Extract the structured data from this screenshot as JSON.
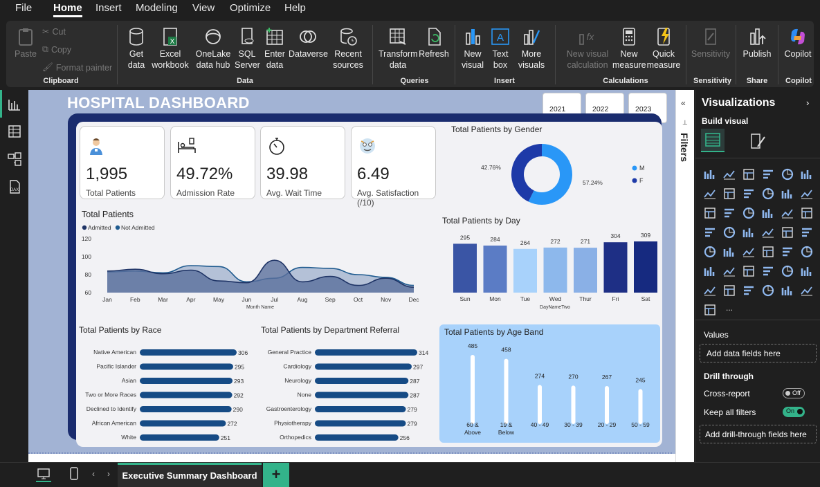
{
  "menu": [
    "File",
    "Home",
    "Insert",
    "Modeling",
    "View",
    "Optimize",
    "Help"
  ],
  "ribbon": {
    "clipboard": {
      "paste": "Paste",
      "cut": "Cut",
      "copy": "Copy",
      "format_painter": "Format painter",
      "group": "Clipboard"
    },
    "data": {
      "get_data": [
        "Get",
        "data"
      ],
      "excel": [
        "Excel",
        "workbook"
      ],
      "onelake": [
        "OneLake",
        "data hub"
      ],
      "sql": [
        "SQL",
        "Server"
      ],
      "enter": [
        "Enter",
        "data"
      ],
      "dataverse": "Dataverse",
      "recent": [
        "Recent",
        "sources"
      ],
      "group": "Data"
    },
    "queries": {
      "transform": [
        "Transform",
        "data"
      ],
      "refresh": "Refresh",
      "group": "Queries"
    },
    "insert": {
      "new_visual": [
        "New",
        "visual"
      ],
      "text_box": [
        "Text",
        "box"
      ],
      "more_visuals": [
        "More",
        "visuals"
      ],
      "group": "Insert"
    },
    "calculations": {
      "new_visual_calc": [
        "New visual",
        "calculation"
      ],
      "new_measure": [
        "New",
        "measure"
      ],
      "quick_measure": [
        "Quick",
        "measure"
      ],
      "group": "Calculations"
    },
    "sensitivity": {
      "label": "Sensitivity",
      "group": "Sensitivity"
    },
    "share": {
      "publish": "Publish",
      "group": "Share"
    },
    "copilot": {
      "label": "Copilot",
      "group": "Copilot"
    }
  },
  "dashboard": {
    "title": "HOSPITAL DASHBOARD",
    "years": [
      "2021",
      "2022",
      "2023"
    ],
    "kpis": [
      {
        "value": "1,995",
        "label": "Total Patients",
        "icon": "patient-icon"
      },
      {
        "value": "49.72%",
        "label": "Admission Rate",
        "icon": "hospital-bed-icon"
      },
      {
        "value": "39.98",
        "label": "Avg. Wait Time",
        "icon": "stopwatch-icon"
      },
      {
        "value": "6.49",
        "label": "Avg. Satisfaction (/10)",
        "icon": "satisfaction-face-icon"
      }
    ],
    "colors": {
      "navy": "#1a2c6e",
      "light_blue": "#a8d2fb",
      "bar_blue": "#164b85",
      "male": "#2997f7",
      "female": "#1e3aa8"
    }
  },
  "chart_data": [
    {
      "type": "pie",
      "title": "Total Patients by Gender",
      "labels": [
        "M",
        "F"
      ],
      "values": [
        57.24,
        42.76
      ],
      "value_labels": [
        "57.24%",
        "42.76%"
      ],
      "legend": "right",
      "colors": [
        "#2997f7",
        "#1e3aa8"
      ]
    },
    {
      "type": "area",
      "title": "Total Patients",
      "xlabel": "Month Name",
      "ylabel": "",
      "categories": [
        "Jan",
        "Feb",
        "Mar",
        "Apr",
        "May",
        "Jun",
        "Jul",
        "Aug",
        "Sep",
        "Oct",
        "Nov",
        "Dec"
      ],
      "y_ticks": [
        "120",
        "100",
        "80",
        "60"
      ],
      "ylim": [
        60,
        120
      ],
      "legend": "top-left",
      "series": [
        {
          "name": "Admitted",
          "values": [
            84,
            86,
            81,
            85,
            73,
            71,
            96,
            72,
            78,
            68,
            76,
            66
          ]
        },
        {
          "name": "Not Admitted",
          "values": [
            83,
            84,
            82,
            90,
            89,
            72,
            76,
            88,
            87,
            80,
            77,
            68
          ]
        }
      ]
    },
    {
      "type": "bar",
      "title": "Total Patients by Day",
      "xlabel": "DayNameTwo",
      "categories": [
        "Sun",
        "Mon",
        "Tue",
        "Wed",
        "Thur",
        "Fri",
        "Sat"
      ],
      "values": [
        295,
        284,
        264,
        272,
        271,
        304,
        309
      ],
      "labels": [
        "295",
        "284",
        "264",
        "272",
        "271",
        "304",
        "309"
      ],
      "colors": [
        "#3a55a5",
        "#5b7cc5",
        "#a8d2fb",
        "#8db8ec",
        "#8ab0e6",
        "#1e2f85",
        "#162a80"
      ]
    },
    {
      "type": "bar",
      "orientation": "horizontal",
      "title": "Total Patients by Race",
      "categories": [
        "Native American",
        "Pacific Islander",
        "Asian",
        "Two or More Races",
        "Declined to Identify",
        "African American",
        "White"
      ],
      "values": [
        306,
        295,
        293,
        292,
        290,
        272,
        251
      ],
      "labels": [
        "306",
        "295",
        "293",
        "292",
        "290",
        "272",
        "251"
      ]
    },
    {
      "type": "bar",
      "orientation": "horizontal",
      "title": "Total Patients by Department Referral",
      "categories": [
        "General Practice",
        "Cardiology",
        "Neurology",
        "None",
        "Gastroenterology",
        "Physiotherapy",
        "Orthopedics"
      ],
      "values": [
        314,
        297,
        287,
        287,
        279,
        279,
        256
      ],
      "labels": [
        "314",
        "297",
        "287",
        "287",
        "279",
        "279",
        "256"
      ]
    },
    {
      "type": "bar",
      "title": "Total Patients by Age Band",
      "categories": [
        [
          "60 &",
          "Above"
        ],
        [
          "19 &",
          "Below"
        ],
        [
          "40 - 49"
        ],
        [
          "30 - 39"
        ],
        [
          "20 - 29"
        ],
        [
          "50 - 59"
        ]
      ],
      "values": [
        485,
        458,
        274,
        270,
        267,
        245
      ],
      "labels": [
        "485",
        "458",
        "274",
        "270",
        "267",
        "245"
      ]
    }
  ],
  "viz_pane": {
    "title": "Visualizations",
    "build": "Build visual",
    "values": "Values",
    "values_placeholder": "Add data fields here",
    "drill": "Drill through",
    "cross_report": "Cross-report",
    "cross_state": "Off",
    "keep_filters": "Keep all filters",
    "keep_state": "On",
    "drill_placeholder": "Add drill-through fields here",
    "more": "..."
  },
  "filters": {
    "label": "Filters"
  },
  "pages": {
    "active": "Executive Summary Dashboard",
    "add": "+"
  }
}
